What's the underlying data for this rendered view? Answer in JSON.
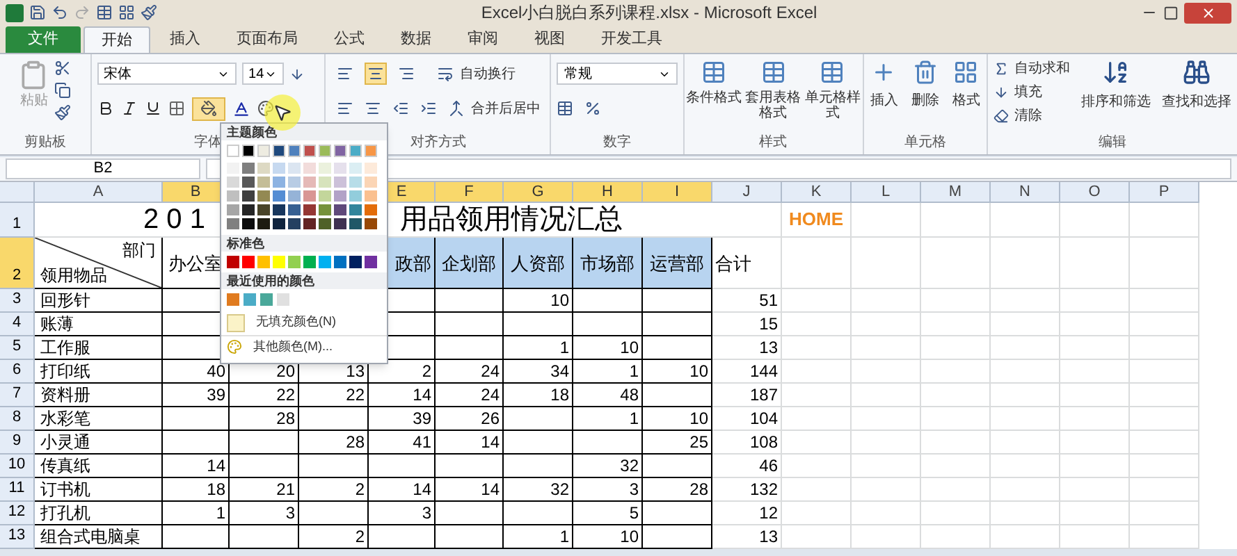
{
  "window": {
    "title": "Excel小白脱白系列课程.xlsx - Microsoft Excel"
  },
  "ribbon_tabs": [
    {
      "label": "文件",
      "kind": "file",
      "selected": false
    },
    {
      "label": "开始",
      "kind": "tab",
      "selected": true
    },
    {
      "label": "插入",
      "kind": "tab",
      "selected": false
    },
    {
      "label": "页面布局",
      "kind": "tab",
      "selected": false
    },
    {
      "label": "公式",
      "kind": "tab",
      "selected": false
    },
    {
      "label": "数据",
      "kind": "tab",
      "selected": false
    },
    {
      "label": "审阅",
      "kind": "tab",
      "selected": false
    },
    {
      "label": "视图",
      "kind": "tab",
      "selected": false
    },
    {
      "label": "开发工具",
      "kind": "tab",
      "selected": false
    }
  ],
  "clipboard": {
    "paste": "粘贴",
    "label": "剪贴板"
  },
  "font": {
    "name": "宋体",
    "size": "14",
    "label": "字体",
    "fill_color_open": true
  },
  "alignment": {
    "wrap": "自动换行",
    "merge": "合并后居中",
    "label": "对齐方式"
  },
  "number": {
    "format": "常规",
    "label": "数字"
  },
  "styles": {
    "buttons": [
      "条件格式",
      "套用表格格式",
      "单元格样式"
    ],
    "label": "样式"
  },
  "cells": {
    "buttons": [
      "插入",
      "删除",
      "格式"
    ],
    "label": "单元格"
  },
  "editing": {
    "small": [
      "自动求和",
      "填充",
      "清除"
    ],
    "buttons": [
      "排序和筛选",
      "查找和选择"
    ],
    "label": "编辑"
  },
  "name_box": "B2",
  "columns_left": [
    {
      "label": "A",
      "selected": false
    },
    {
      "label": "B",
      "selected": true
    }
  ],
  "columns_right": [
    {
      "label": "E",
      "selected": true
    },
    {
      "label": "F",
      "selected": true
    },
    {
      "label": "G",
      "selected": true
    },
    {
      "label": "H",
      "selected": true
    },
    {
      "label": "I",
      "selected": true
    },
    {
      "label": "J",
      "selected": false
    },
    {
      "label": "K",
      "selected": false
    },
    {
      "label": "L",
      "selected": false
    },
    {
      "label": "M",
      "selected": false
    },
    {
      "label": "N",
      "selected": false
    },
    {
      "label": "O",
      "selected": false
    },
    {
      "label": "P",
      "selected": false
    }
  ],
  "row_headers": [
    {
      "label": "1",
      "selected": false
    },
    {
      "label": "2",
      "selected": true
    },
    {
      "label": "3",
      "selected": false
    },
    {
      "label": "4",
      "selected": false
    },
    {
      "label": "5",
      "selected": false
    },
    {
      "label": "6",
      "selected": false
    },
    {
      "label": "7",
      "selected": false
    },
    {
      "label": "8",
      "selected": false
    },
    {
      "label": "9",
      "selected": false
    },
    {
      "label": "10",
      "selected": false
    },
    {
      "label": "11",
      "selected": false
    },
    {
      "label": "12",
      "selected": false
    },
    {
      "label": "13",
      "selected": false
    }
  ],
  "sheet": {
    "title_left": "2 0 1",
    "title_right": "用品领用情况汇总",
    "home": "HOME",
    "corner_top": "部门",
    "corner_bottom": "领用物品",
    "headers": {
      "B": "办公室",
      "E": "政部",
      "F": "企划部",
      "G": "人资部",
      "H": "市场部",
      "I": "运营部"
    },
    "total_header": "合计",
    "rows": [
      {
        "item": "回形针",
        "cells": {
          "G": "10"
        },
        "total": "51"
      },
      {
        "item": "账薄",
        "total": "15"
      },
      {
        "item": "工作服",
        "cells": {
          "G": "1",
          "H": "10"
        },
        "total": "13"
      },
      {
        "item": "打印纸",
        "cells": {
          "B": "40",
          "C": "20",
          "D": "13",
          "E": "2",
          "F": "24",
          "G": "34",
          "H": "1",
          "I": "10"
        },
        "total": "144"
      },
      {
        "item": "资料册",
        "cells": {
          "B": "39",
          "C": "22",
          "D": "22",
          "E": "14",
          "F": "24",
          "G": "18",
          "H": "48"
        },
        "total": "187"
      },
      {
        "item": "水彩笔",
        "cells": {
          "C": "28",
          "E": "39",
          "F": "26",
          "H": "1",
          "I": "10"
        },
        "total": "104"
      },
      {
        "item": "小灵通",
        "cells": {
          "D": "28",
          "E": "41",
          "F": "14",
          "I": "25"
        },
        "total": "108"
      },
      {
        "item": "传真纸",
        "cells": {
          "B": "14",
          "H": "32"
        },
        "total": "46"
      },
      {
        "item": "订书机",
        "cells": {
          "B": "18",
          "C": "21",
          "D": "2",
          "E": "14",
          "F": "14",
          "G": "32",
          "H": "3",
          "I": "28"
        },
        "total": "132"
      },
      {
        "item": "打孔机",
        "cells": {
          "B": "1",
          "C": "3",
          "E": "3",
          "H": "5"
        },
        "total": "12"
      },
      {
        "item": "组合式电脑桌",
        "cells": {
          "D": "2",
          "G": "1",
          "H": "10"
        },
        "total": "13"
      }
    ]
  },
  "color_menu": {
    "theme_title": "主题颜色",
    "theme_colors": [
      {
        "color": "#ffffff",
        "shades": [
          {
            "color": "#f2f2f2"
          },
          {
            "color": "#d9d9d9"
          },
          {
            "color": "#bfbfbf"
          },
          {
            "color": "#a6a6a6"
          },
          {
            "color": "#808080"
          }
        ]
      },
      {
        "color": "#000000",
        "shades": [
          {
            "color": "#7f7f7f"
          },
          {
            "color": "#595959"
          },
          {
            "color": "#404040"
          },
          {
            "color": "#262626"
          },
          {
            "color": "#0d0d0d"
          }
        ]
      },
      {
        "color": "#eeece1",
        "shades": [
          {
            "color": "#ddd9c3"
          },
          {
            "color": "#c4bd97"
          },
          {
            "color": "#938953"
          },
          {
            "color": "#494429"
          },
          {
            "color": "#1d1b10"
          }
        ]
      },
      {
        "color": "#1f497d",
        "shades": [
          {
            "color": "#c6d9f0"
          },
          {
            "color": "#8db3e2"
          },
          {
            "color": "#548dd4"
          },
          {
            "color": "#17365d"
          },
          {
            "color": "#0f243e"
          }
        ]
      },
      {
        "color": "#4f81bd",
        "shades": [
          {
            "color": "#dbe5f1"
          },
          {
            "color": "#b8cce4"
          },
          {
            "color": "#95b3d7"
          },
          {
            "color": "#366092"
          },
          {
            "color": "#244061"
          }
        ]
      },
      {
        "color": "#c0504d",
        "shades": [
          {
            "color": "#f2dcdb"
          },
          {
            "color": "#e5b9b7"
          },
          {
            "color": "#d99694"
          },
          {
            "color": "#953734"
          },
          {
            "color": "#632423"
          }
        ]
      },
      {
        "color": "#9bbb59",
        "shades": [
          {
            "color": "#ebf1dd"
          },
          {
            "color": "#d7e3bc"
          },
          {
            "color": "#c3d69b"
          },
          {
            "color": "#76923c"
          },
          {
            "color": "#4f6128"
          }
        ]
      },
      {
        "color": "#8064a2",
        "shades": [
          {
            "color": "#e5e0ec"
          },
          {
            "color": "#ccc1d9"
          },
          {
            "color": "#b2a2c7"
          },
          {
            "color": "#5f497a"
          },
          {
            "color": "#3f3151"
          }
        ]
      },
      {
        "color": "#4bacc6",
        "shades": [
          {
            "color": "#dbeef3"
          },
          {
            "color": "#b7dde8"
          },
          {
            "color": "#92cddc"
          },
          {
            "color": "#31859b"
          },
          {
            "color": "#205867"
          }
        ]
      },
      {
        "color": "#f79646",
        "shades": [
          {
            "color": "#fdeada"
          },
          {
            "color": "#fbd5b5"
          },
          {
            "color": "#fac08f"
          },
          {
            "color": "#e36c09"
          },
          {
            "color": "#974806"
          }
        ]
      }
    ],
    "standard_title": "标准色",
    "standard_colors": [
      {
        "color": "#c00000"
      },
      {
        "color": "#ff0000"
      },
      {
        "color": "#ffc000"
      },
      {
        "color": "#ffff00"
      },
      {
        "color": "#92d050"
      },
      {
        "color": "#00b050"
      },
      {
        "color": "#00b0f0"
      },
      {
        "color": "#0070c0"
      },
      {
        "color": "#002060"
      },
      {
        "color": "#7030a0"
      }
    ],
    "recent_title": "最近使用的颜色",
    "recent_colors": [
      {
        "color": "#e07b1f"
      },
      {
        "color": "#4bacc6"
      },
      {
        "color": "#4aa89a"
      },
      {
        "color": "#e0e0e0"
      }
    ],
    "no_fill": "无填充颜色(N)",
    "more": "其他颜色(M)..."
  }
}
